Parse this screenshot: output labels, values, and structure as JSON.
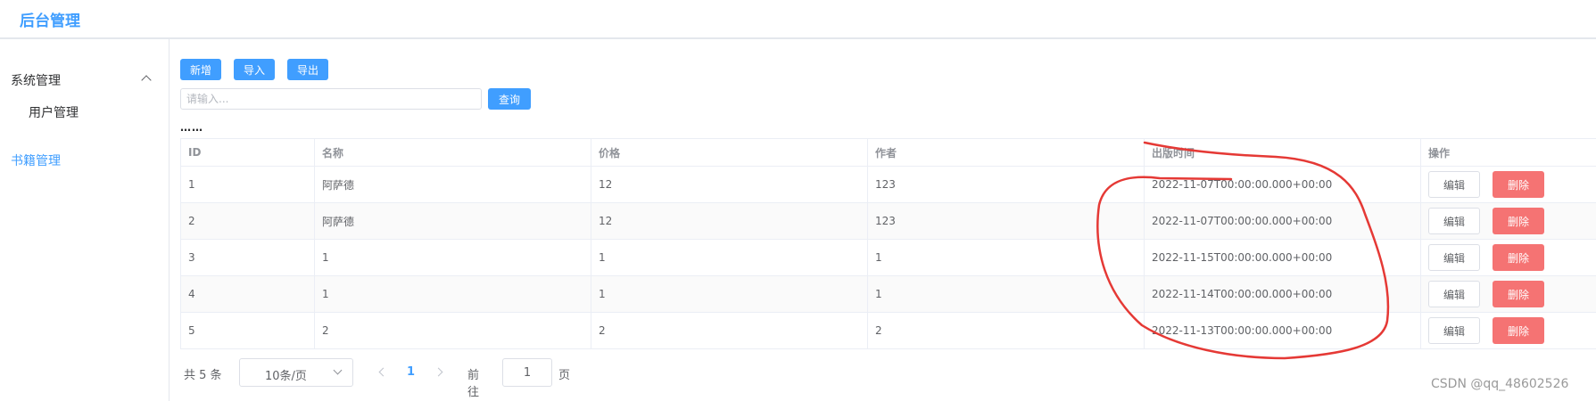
{
  "header": {
    "title": "后台管理"
  },
  "sidebar": {
    "group_label": "系统管理",
    "sub_item": "用户管理",
    "books_item": "书籍管理"
  },
  "toolbar": {
    "add": "新增",
    "import": "导入",
    "export": "导出"
  },
  "search": {
    "placeholder": "请输入...",
    "button": "查询"
  },
  "dots": "……",
  "table": {
    "columns": [
      "ID",
      "名称",
      "价格",
      "作者",
      "出版时间",
      "操作"
    ],
    "rows": [
      [
        "1",
        "阿萨德",
        "12",
        "123",
        "2022-11-07T00:00:00.000+00:00"
      ],
      [
        "2",
        "阿萨德",
        "12",
        "123",
        "2022-11-07T00:00:00.000+00:00"
      ],
      [
        "3",
        "1",
        "1",
        "1",
        "2022-11-15T00:00:00.000+00:00"
      ],
      [
        "4",
        "1",
        "1",
        "1",
        "2022-11-14T00:00:00.000+00:00"
      ],
      [
        "5",
        "2",
        "2",
        "2",
        "2022-11-13T00:00:00.000+00:00"
      ]
    ],
    "edit_label": "编辑",
    "delete_label": "删除"
  },
  "pagination": {
    "total": "共 5 条",
    "page_size": "10条/页",
    "current_page": "1",
    "goto_label": "前往",
    "goto_value": "1",
    "page_suffix": "页"
  },
  "watermark": "CSDN @qq_48602526",
  "colors": {
    "accent": "#409eff",
    "danger": "#f56c6c",
    "annotation": "#e53935"
  }
}
